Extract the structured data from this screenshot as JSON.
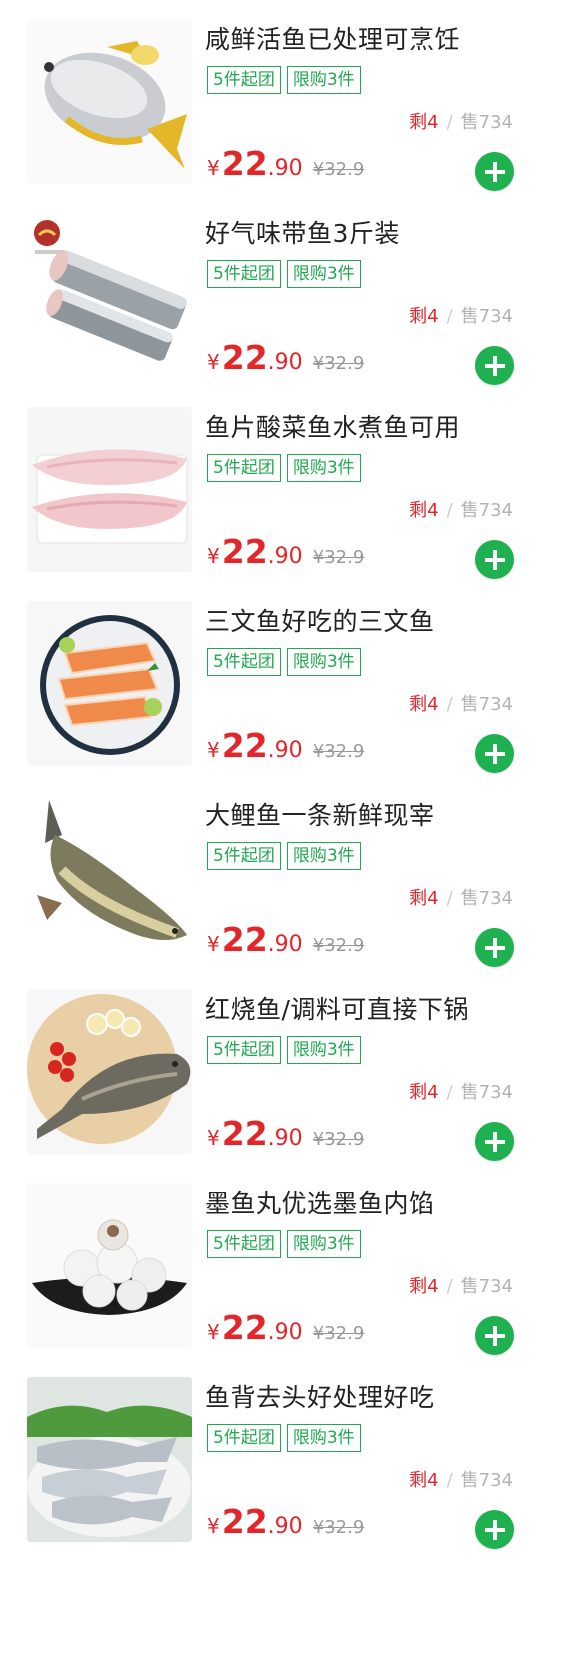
{
  "products": [
    {
      "title": "咸鲜活鱼已处理可烹饪",
      "tags": [
        "5件起团",
        "限购3件"
      ],
      "remaining": "剩4",
      "sold": "售734",
      "currency": "¥",
      "price_int": "22",
      "price_dec": ".90",
      "original": "¥32.9",
      "image": "golden-pompano-fish"
    },
    {
      "title": "好气味带鱼3斤装",
      "tags": [
        "5件起团",
        "限购3件"
      ],
      "remaining": "剩4",
      "sold": "售734",
      "currency": "¥",
      "price_int": "22",
      "price_dec": ".90",
      "original": "¥32.9",
      "image": "hairtail-fish-pieces"
    },
    {
      "title": "鱼片酸菜鱼水煮鱼可用",
      "tags": [
        "5件起团",
        "限购3件"
      ],
      "remaining": "剩4",
      "sold": "售734",
      "currency": "¥",
      "price_int": "22",
      "price_dec": ".90",
      "original": "¥32.9",
      "image": "fish-fillets-on-board"
    },
    {
      "title": "三文鱼好吃的三文鱼",
      "tags": [
        "5件起团",
        "限购3件"
      ],
      "remaining": "剩4",
      "sold": "售734",
      "currency": "¥",
      "price_int": "22",
      "price_dec": ".90",
      "original": "¥32.9",
      "image": "salmon-slices-plate"
    },
    {
      "title": "大鲤鱼一条新鲜现宰",
      "tags": [
        "5件起团",
        "限购3件"
      ],
      "remaining": "剩4",
      "sold": "售734",
      "currency": "¥",
      "price_int": "22",
      "price_dec": ".90",
      "original": "¥32.9",
      "image": "grass-carp"
    },
    {
      "title": "红烧鱼/调料可直接下锅",
      "tags": [
        "5件起团",
        "限购3件"
      ],
      "remaining": "剩4",
      "sold": "售734",
      "currency": "¥",
      "price_int": "22",
      "price_dec": ".90",
      "original": "¥32.9",
      "image": "perch-on-cutting-board"
    },
    {
      "title": "墨鱼丸优选墨鱼内馅",
      "tags": [
        "5件起团",
        "限购3件"
      ],
      "remaining": "剩4",
      "sold": "售734",
      "currency": "¥",
      "price_int": "22",
      "price_dec": ".90",
      "original": "¥32.9",
      "image": "cuttlefish-balls-bowl"
    },
    {
      "title": "鱼背去头好处理好吃",
      "tags": [
        "5件起团",
        "限购3件"
      ],
      "remaining": "剩4",
      "sold": "售734",
      "currency": "¥",
      "price_int": "22",
      "price_dec": ".90",
      "original": "¥32.9",
      "image": "headless-fish-plate"
    }
  ],
  "colors": {
    "accent_green": "#1fb050",
    "tag_green": "#21a850",
    "price_red": "#e3262a",
    "muted_gray": "#b3b3b3"
  }
}
